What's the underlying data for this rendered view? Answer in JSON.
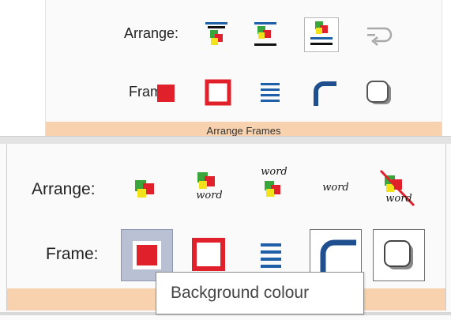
{
  "panel_top": {
    "arrange_label": "Arrange:",
    "frame_label": "Frame:",
    "footer_label": "Arrange Frames",
    "arrange_buttons": [
      "bring-to-front-icon",
      "send-to-back-icon",
      "in-line-icon",
      "text-wrap-icon"
    ],
    "frame_buttons": [
      "background-colour-icon",
      "border-colour-icon",
      "line-style-icon",
      "rounded-corner-icon",
      "shadow-icon"
    ]
  },
  "panel_bottom": {
    "arrange_label": "Arrange:",
    "frame_label": "Frame:",
    "word_1": "word",
    "word_2": "word",
    "word_3": "word",
    "word_4": "word",
    "tooltip": "Background colour"
  },
  "colors": {
    "red": "#e0202a",
    "green": "#3aa53a",
    "yellow": "#f2e21c",
    "blue": "#1f5fa8",
    "footer": "#f8d2ae"
  }
}
